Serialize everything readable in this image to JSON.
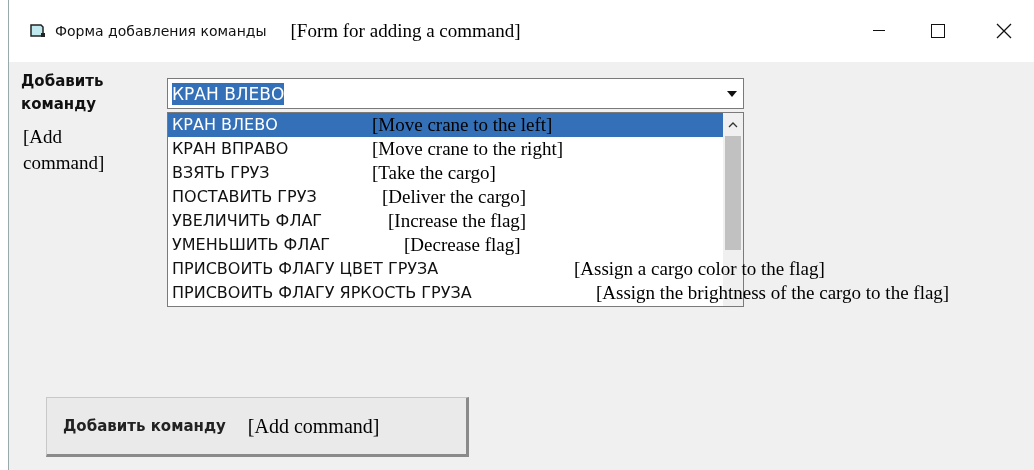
{
  "window": {
    "title": "Форма добавления команды",
    "title_note": "[Form for adding a command]"
  },
  "command_field": {
    "label": "Добавить команду",
    "label_note": "[Add command]",
    "value": "КРАН ВЛЕВО",
    "expanded": true,
    "options": [
      {
        "label": "КРАН ВЛЕВО",
        "note": "[Move crane to the left]",
        "selected": true
      },
      {
        "label": "КРАН ВПРАВО",
        "note": "[Move crane to the right]",
        "selected": false
      },
      {
        "label": "ВЗЯТЬ ГРУЗ",
        "note": "[Take the cargo]",
        "selected": false
      },
      {
        "label": "ПОСТАВИТЬ ГРУЗ",
        "note": "[Deliver the cargo]",
        "selected": false
      },
      {
        "label": "УВЕЛИЧИТЬ ФЛАГ",
        "note": "[Increase the flag]",
        "selected": false
      },
      {
        "label": "УМЕНЬШИТЬ ФЛАГ",
        "note": "[Decrease flag]",
        "selected": false
      },
      {
        "label": "ПРИСВОИТЬ ФЛАГУ ЦВЕТ ГРУЗА",
        "note": "[Assign a cargo color to the flag]",
        "selected": false
      },
      {
        "label": "ПРИСВОИТЬ ФЛАГУ ЯРКОСТЬ ГРУЗА",
        "note": "[Assign the brightness of the cargo to the flag]",
        "selected": false
      }
    ]
  },
  "add_button": {
    "label": "Добавить команду",
    "note": "[Add command]"
  }
}
